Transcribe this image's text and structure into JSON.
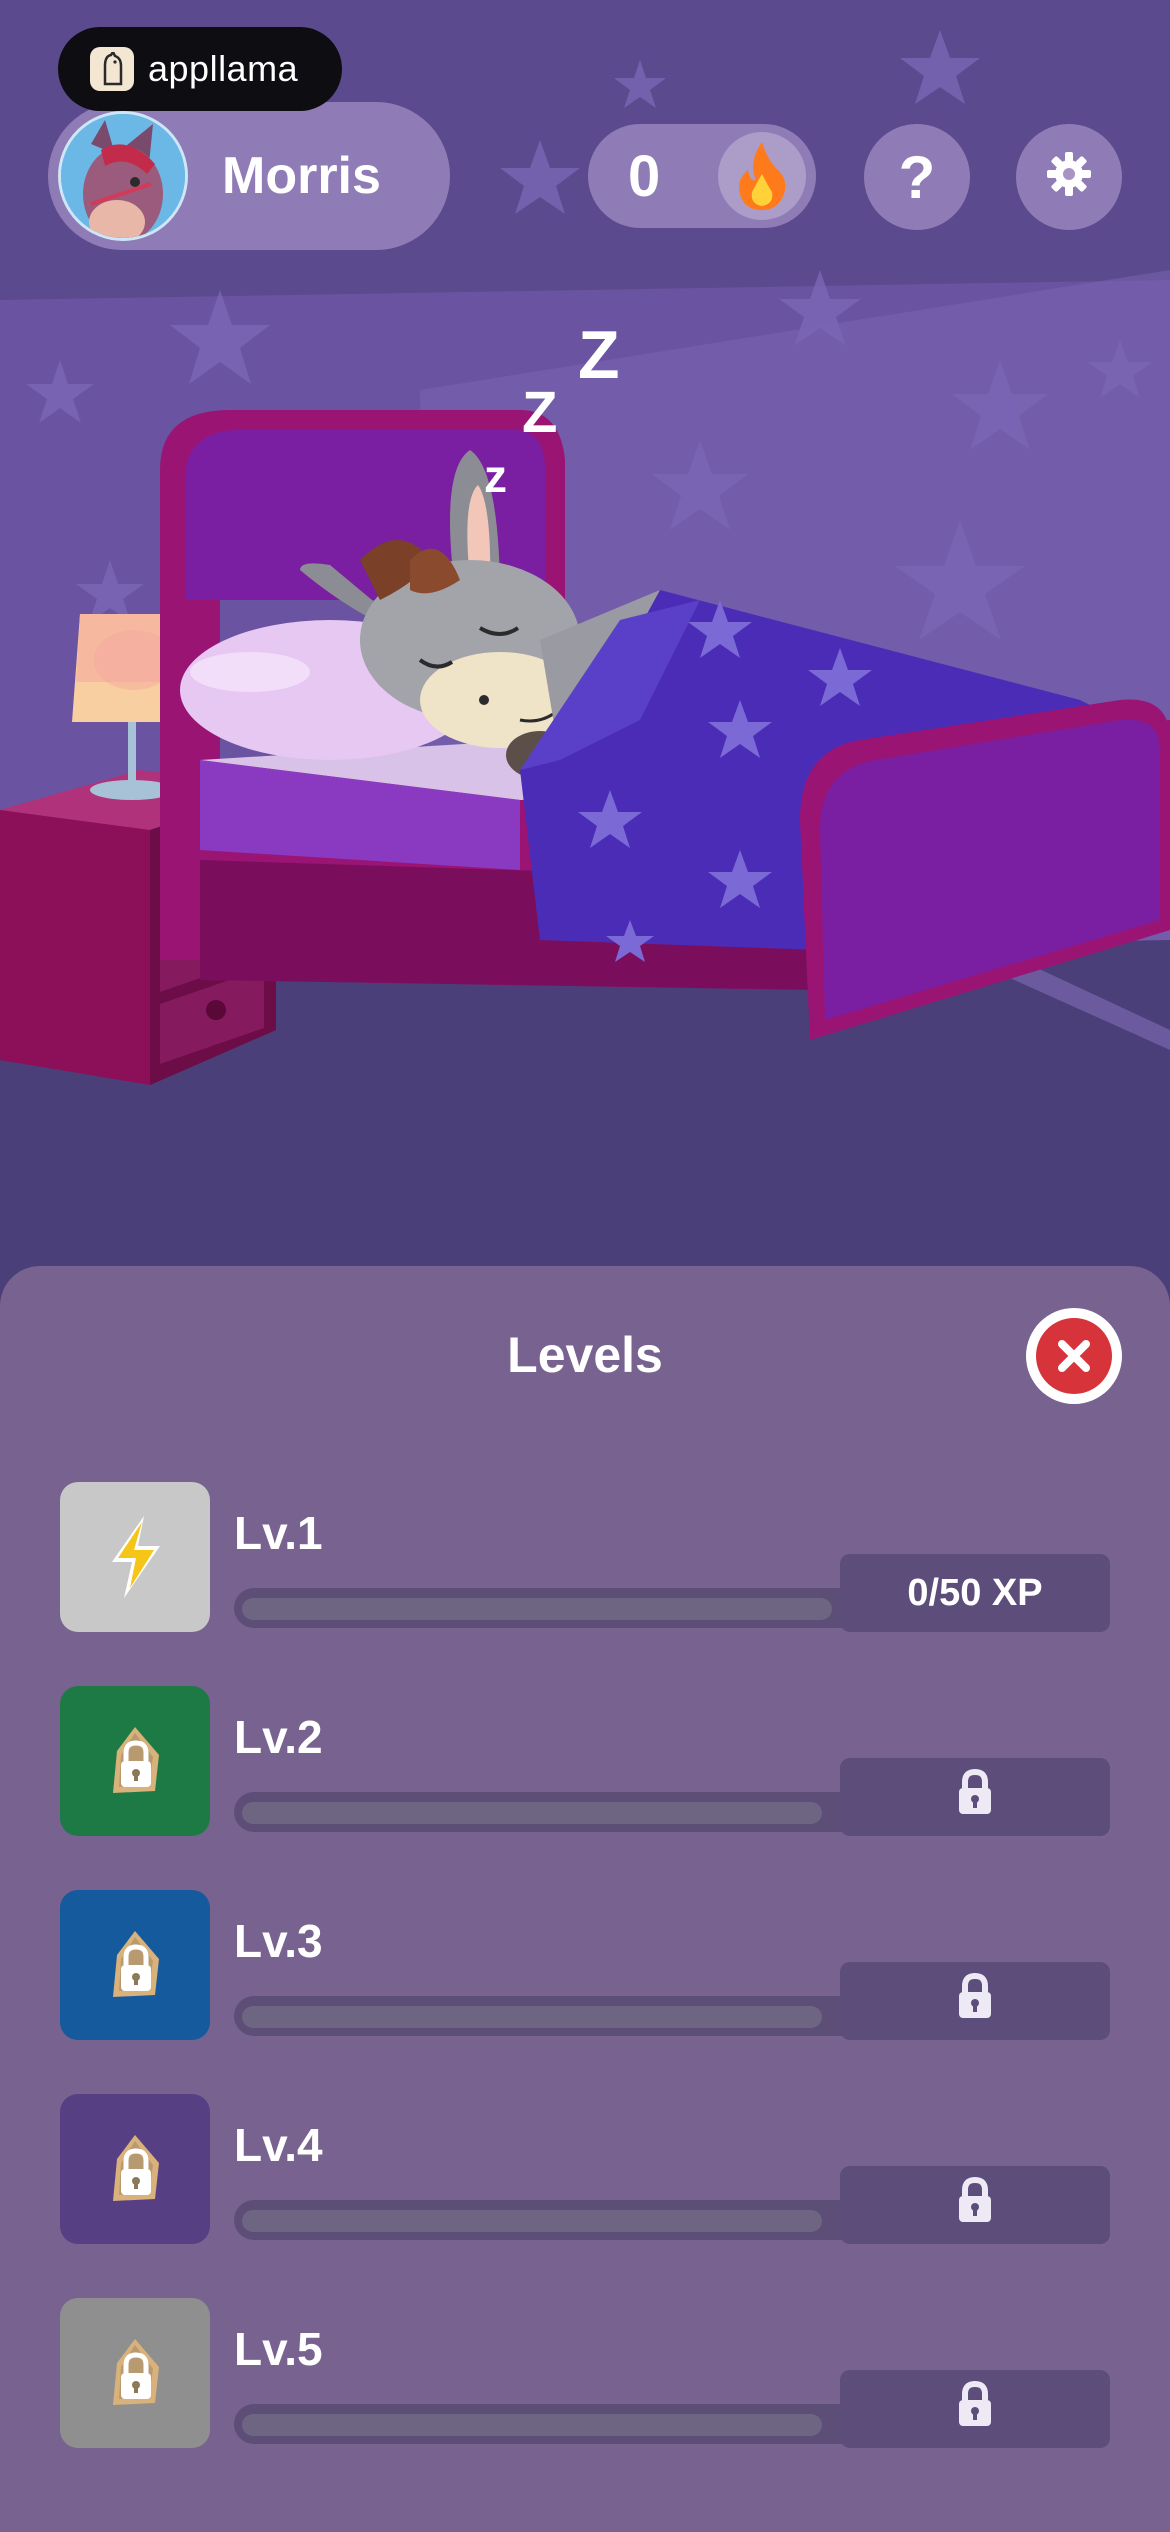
{
  "brand": {
    "name": "appllama",
    "logo_icon": "llama-logo-icon"
  },
  "profile": {
    "name": "Morris",
    "avatar_icon": "donkey-avatar-icon"
  },
  "streak": {
    "count": "0",
    "icon": "flame-icon"
  },
  "header_buttons": {
    "help_label": "?",
    "settings_icon": "gear-icon"
  },
  "scene": {
    "sleep_letters": [
      "Z",
      "Z",
      "z"
    ]
  },
  "levels_panel": {
    "title": "Levels",
    "close_icon": "close-icon",
    "levels": [
      {
        "label": "Lv.1",
        "progress_text": "0/50 XP",
        "locked": false,
        "icon": "lightning-icon",
        "color": "#c8c8c8",
        "progress": 0
      },
      {
        "label": "Lv.2",
        "progress_text": "",
        "locked": true,
        "icon": "lock-icon",
        "color": "#1e7a44",
        "progress": 0
      },
      {
        "label": "Lv.3",
        "progress_text": "",
        "locked": true,
        "icon": "lock-icon",
        "color": "#155a9c",
        "progress": 0
      },
      {
        "label": "Lv.4",
        "progress_text": "",
        "locked": true,
        "icon": "lock-icon",
        "color": "#573f83",
        "progress": 0
      },
      {
        "label": "Lv.5",
        "progress_text": "",
        "locked": true,
        "icon": "lock-icon",
        "color": "#8f8f8f",
        "progress": 0
      }
    ]
  }
}
